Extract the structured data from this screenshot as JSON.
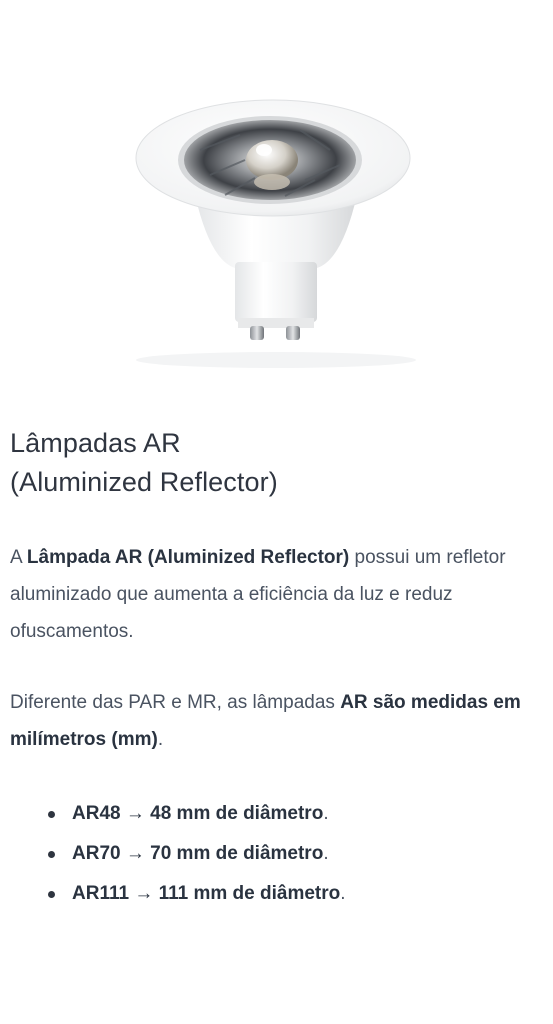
{
  "heading": {
    "line1": "Lâmpadas AR",
    "line2": "(Aluminized Reflector)"
  },
  "intro": {
    "p1_prefix": "A ",
    "p1_bold": "Lâmpada AR (Aluminized Reflector)",
    "p1_suffix": " possui um refletor aluminizado que aumenta a eficiência da luz e reduz ofuscamentos.",
    "p2_prefix": "Diferente das PAR e MR, as lâmpadas ",
    "p2_bold": "AR são medidas em milímetros (mm)",
    "p2_suffix": "."
  },
  "sizes": [
    {
      "bold": "AR48 → 48 mm de diâmetro",
      "tail": "."
    },
    {
      "bold": "AR70 → 70 mm de diâmetro",
      "tail": "."
    },
    {
      "bold": "AR111 → 111 mm de diâmetro",
      "tail": "."
    }
  ],
  "image": {
    "icon": "ar-lamp-illustration"
  }
}
